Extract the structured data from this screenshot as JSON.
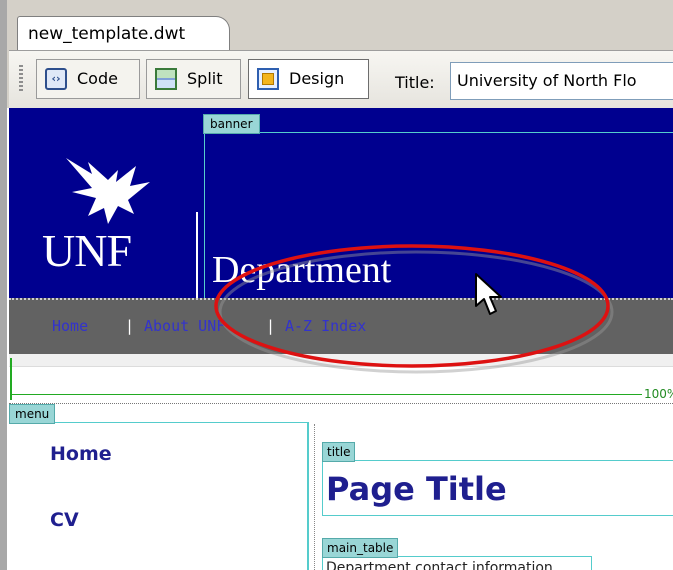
{
  "window": {
    "doc_tab": "new_template.dwt"
  },
  "toolbar": {
    "code_label": "Code",
    "split_label": "Split",
    "design_label": "Design",
    "title_label": "Title:",
    "title_value": "University of North Flo"
  },
  "banner": {
    "region_tag": "banner",
    "logo_text": "UNF",
    "department": "Department",
    "colors": {
      "background": "#00008f",
      "nav_bar": "#626262"
    }
  },
  "nav": {
    "links": [
      "Home",
      "About UNF",
      "A-Z Index"
    ],
    "separator": "|"
  },
  "ruler": {
    "width_label": "100%"
  },
  "menu": {
    "region_tag": "menu",
    "items": [
      "Home",
      "CV"
    ]
  },
  "content": {
    "title_tag": "title",
    "page_title": "Page Title",
    "main_tag": "main_table",
    "main_text": "Department contact information"
  },
  "annotation": {
    "highlight_color": "#dd1111",
    "icons": [
      "red-ellipse-highlight",
      "mouse-pointer-icon"
    ]
  }
}
